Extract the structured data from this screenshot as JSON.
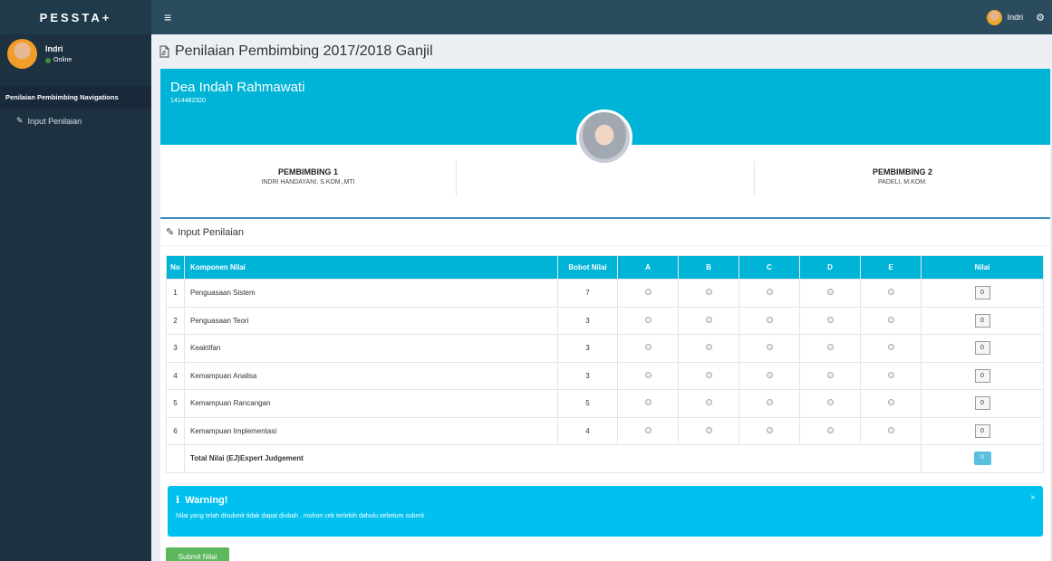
{
  "header": {
    "logo": "PESSTA+",
    "menu_icon": "hamburger-icon",
    "user_name": "Indri",
    "settings_icon": "cogs-icon"
  },
  "sidebar": {
    "user_name": "Indri",
    "status": "Online",
    "nav_header": "Penilaian Pembimbing Navigations",
    "items": [
      {
        "label": "Input Penilaian",
        "icon": "edit-icon"
      }
    ]
  },
  "page": {
    "title": "Penilaian Pembimbing 2017/2018 Ganjil",
    "title_icon": "pdf-file-icon"
  },
  "profile": {
    "name": "Dea Indah Rahmawati",
    "nim": "1414482320",
    "pembimbing1_title": "PEMBIMBING 1",
    "pembimbing1_name": "INDRI HANDAYANI, S.KOM.,MTI",
    "pembimbing2_title": "PEMBIMBING 2",
    "pembimbing2_name": "PADELI, M.KOM."
  },
  "form": {
    "title": "Input Penilaian",
    "title_icon": "edit-icon",
    "columns": [
      "No",
      "Komponen Nilai",
      "Bobot Nilai",
      "A",
      "B",
      "C",
      "D",
      "E",
      "Nilai"
    ],
    "rows": [
      {
        "no": "1",
        "komponen": "Penguasaan Sistem",
        "bobot": "7",
        "nilai": "0"
      },
      {
        "no": "2",
        "komponen": "Penguasaan Teori",
        "bobot": "3",
        "nilai": "0"
      },
      {
        "no": "3",
        "komponen": "Keaktifan",
        "bobot": "3",
        "nilai": "0"
      },
      {
        "no": "4",
        "komponen": "Kemampuan Analisa",
        "bobot": "3",
        "nilai": "0"
      },
      {
        "no": "5",
        "komponen": "Kemampuan Rancangan",
        "bobot": "5",
        "nilai": "0"
      },
      {
        "no": "6",
        "komponen": "Kemampuan Implementasi",
        "bobot": "4",
        "nilai": "0"
      }
    ],
    "total_label": "Total Nilai (EJ)Expert Judgement",
    "total_value": "0"
  },
  "warning": {
    "title": "Warning!",
    "message": "Nilai yang telah disubmit tidak dapat diubah , mohon cek terlebih dahulu sebelum submit .",
    "close": "×"
  },
  "submit_label": "Submit Nilai",
  "colors": {
    "accent": "#00b4d8",
    "warning": "#00c0ef",
    "submit": "#5cb85c",
    "sidebar": "#1d3140",
    "header": "#2b4c5e"
  }
}
